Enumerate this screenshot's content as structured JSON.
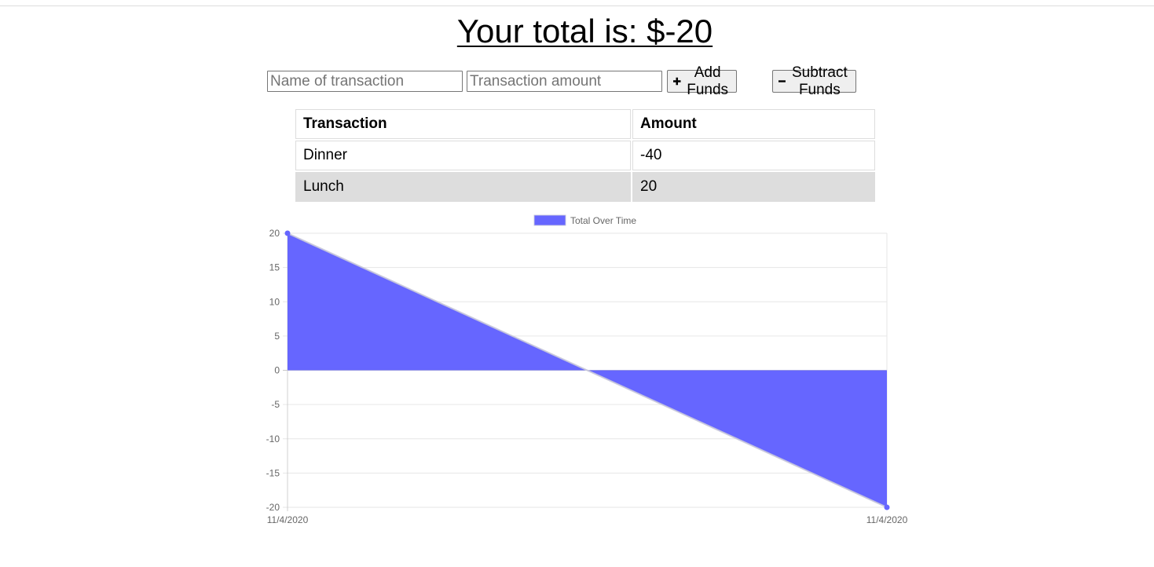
{
  "header": {
    "total_text": "Your total is: $-20"
  },
  "form": {
    "name_placeholder": "Name of transaction",
    "amount_placeholder": "Transaction amount",
    "add_label": "Add Funds",
    "subtract_label": "Subtract Funds",
    "add_icon": "plus-icon",
    "subtract_icon": "minus-icon"
  },
  "table": {
    "headers": [
      "Transaction",
      "Amount"
    ],
    "rows": [
      {
        "name": "Dinner",
        "amount": "-40"
      },
      {
        "name": "Lunch",
        "amount": "20"
      }
    ]
  },
  "chart_data": {
    "type": "area",
    "title": "",
    "legend": "Total Over Time",
    "legend_position": "top-center",
    "x": [
      "11/4/2020",
      "11/4/2020"
    ],
    "series": [
      {
        "name": "Total Over Time",
        "values": [
          20,
          -20
        ]
      }
    ],
    "ylim": [
      -20,
      20
    ],
    "yticks": [
      20,
      15,
      10,
      5,
      0,
      -5,
      -10,
      -15,
      -20
    ],
    "grid": true,
    "color": "#6666ff"
  }
}
